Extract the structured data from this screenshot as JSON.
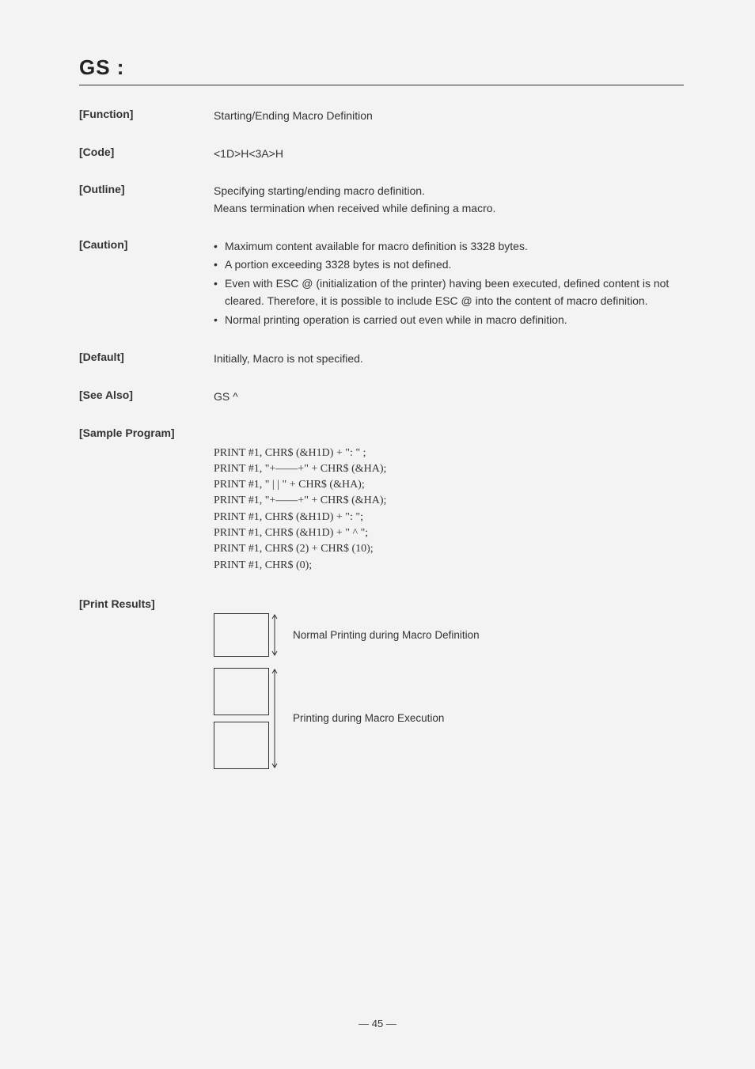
{
  "title": "GS :",
  "rows": {
    "function": {
      "label": "[Function]",
      "value": "Starting/Ending Macro Definition"
    },
    "code": {
      "label": "[Code]",
      "value": "<1D>H<3A>H"
    },
    "outline": {
      "label": "[Outline]",
      "line1": "Specifying starting/ending macro definition.",
      "line2": "Means termination when received while defining a macro."
    },
    "caution": {
      "label": "[Caution]",
      "items": [
        "Maximum content available for macro definition is 3328 bytes.",
        "A portion exceeding 3328 bytes is not defined.",
        "Even with ESC @ (initialization of the printer) having been executed, defined content is not cleared.  Therefore, it is possible to include ESC @ into the content of macro definition.",
        "Normal printing operation is carried out even while in macro definition."
      ]
    },
    "default": {
      "label": "[Default]",
      "value": "Initially, Macro is not specified."
    },
    "seealso": {
      "label": "[See Also]",
      "value": "GS ^"
    },
    "sample": {
      "label": "[Sample Program]",
      "lines": [
        "PRINT #1, CHR$ (&H1D) + \": \" ;",
        "PRINT #1, \"+——+\" + CHR$ (&HA);",
        "PRINT #1, \"  | | \" + CHR$ (&HA);",
        "PRINT #1, \"+——+\" + CHR$ (&HA);",
        "PRINT #1, CHR$ (&H1D) + \": \";",
        "PRINT #1, CHR$ (&H1D) + \" ^ \";",
        "PRINT #1, CHR$ (2) + CHR$ (10);",
        "PRINT #1, CHR$ (0);"
      ]
    },
    "results": {
      "label": "[Print Results]",
      "caption1": "Normal Printing during Macro Definition",
      "caption2": "Printing during Macro Execution"
    }
  },
  "footer": "— 45 —"
}
